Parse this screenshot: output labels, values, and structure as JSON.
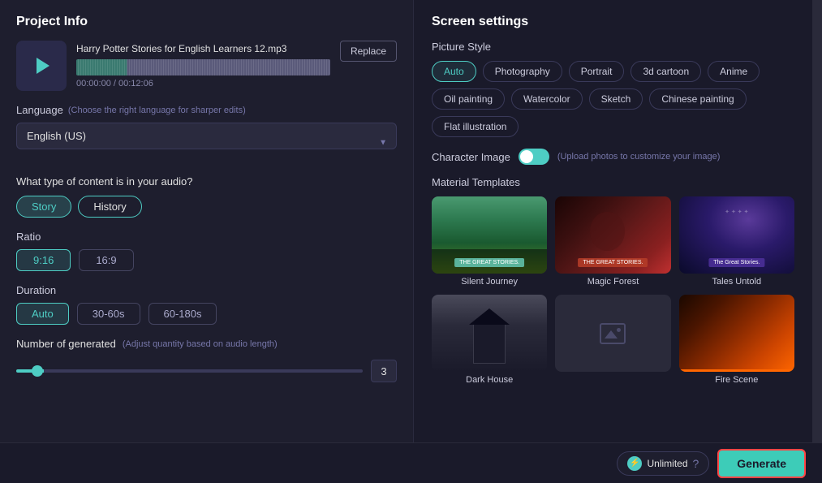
{
  "left_panel": {
    "title": "Project Info",
    "audio": {
      "filename": "Harry Potter Stories for English Learners 12.mp3",
      "current_time": "00:00:00",
      "total_time": "00:12:06",
      "replace_label": "Replace"
    },
    "language": {
      "label": "Language",
      "hint": "(Choose the right language for sharper edits)",
      "value": "English (US)"
    },
    "content_type": {
      "question": "What type of content is in your audio?",
      "options": [
        {
          "label": "Story",
          "active": true
        },
        {
          "label": "History",
          "active": false
        }
      ]
    },
    "ratio": {
      "label": "Ratio",
      "options": [
        {
          "label": "9:16",
          "active": true
        },
        {
          "label": "16:9",
          "active": false
        }
      ]
    },
    "duration": {
      "label": "Duration",
      "options": [
        {
          "label": "Auto",
          "active": true
        },
        {
          "label": "30-60s",
          "active": false
        },
        {
          "label": "60-180s",
          "active": false
        }
      ]
    },
    "num_generated": {
      "label": "Number of generated",
      "hint": "(Adjust quantity based on audio length)",
      "value": "3"
    }
  },
  "right_panel": {
    "title": "Screen settings",
    "picture_style": {
      "label": "Picture Style",
      "options": [
        {
          "label": "Auto",
          "active": true
        },
        {
          "label": "Photography",
          "active": false
        },
        {
          "label": "Portrait",
          "active": false
        },
        {
          "label": "3d cartoon",
          "active": false
        },
        {
          "label": "Anime",
          "active": false
        },
        {
          "label": "Oil painting",
          "active": false
        },
        {
          "label": "Watercolor",
          "active": false
        },
        {
          "label": "Sketch",
          "active": false
        },
        {
          "label": "Chinese painting",
          "active": false
        },
        {
          "label": "Flat illustration",
          "active": false
        }
      ]
    },
    "character_image": {
      "label": "Character Image",
      "hint": "(Upload photos to customize your image)",
      "enabled": true
    },
    "material_templates": {
      "label": "Material Templates",
      "items": [
        {
          "name": "Silent Journey",
          "thumb_type": "silent-journey"
        },
        {
          "name": "Magic Forest",
          "thumb_type": "magic-forest"
        },
        {
          "name": "Tales Untold",
          "thumb_type": "tales-untold"
        },
        {
          "name": "Dark House",
          "thumb_type": "dark-house"
        },
        {
          "name": "",
          "thumb_type": "placeholder"
        },
        {
          "name": "Fire Scene",
          "thumb_type": "fire"
        }
      ]
    }
  },
  "bottom_bar": {
    "unlimited_label": "Unlimited",
    "generate_label": "Generate",
    "unlimited_icon": "⚡"
  }
}
